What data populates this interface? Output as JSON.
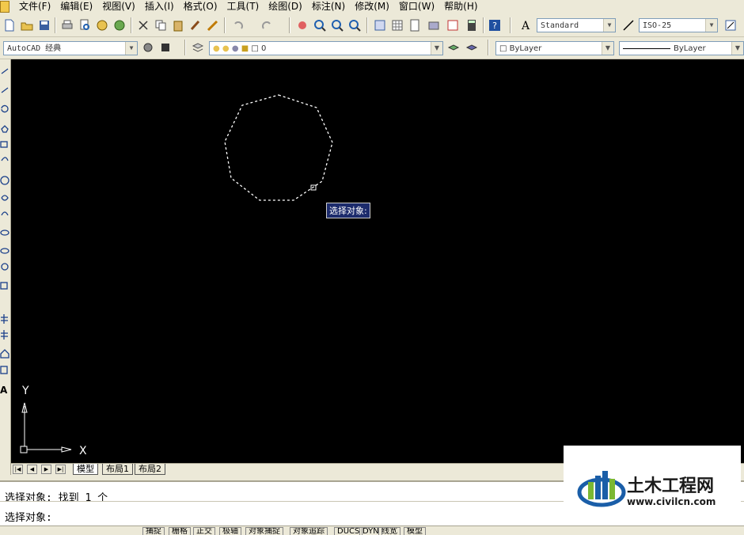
{
  "menu": [
    "文件(F)",
    "编辑(E)",
    "视图(V)",
    "插入(I)",
    "格式(O)",
    "工具(T)",
    "绘图(D)",
    "标注(N)",
    "修改(M)",
    "窗口(W)",
    "帮助(H)"
  ],
  "toolbar": {
    "text_style": "Standard",
    "dim_style": "ISO-25",
    "workspace": "AutoCAD 经典",
    "layer": "0",
    "color": "ByLayer",
    "linetype": "ByLayer"
  },
  "canvas": {
    "tooltip": "选择对象:",
    "ucs_y": "Y",
    "ucs_x": "X"
  },
  "tabs": [
    "模型",
    "布局1",
    "布局2"
  ],
  "command": {
    "line1": "选择对象: 找到 1 个",
    "line2": "选择对象:"
  },
  "status": [
    "捕捉",
    "栅格",
    "正交",
    "极轴",
    "对象捕捉",
    "对象追踪",
    "DUCS",
    "DYN",
    "线宽",
    "模型"
  ],
  "watermark": {
    "name": "土木工程网",
    "url": "www.civilcn.com"
  },
  "colors": {
    "canvas": "#000000",
    "chrome": "#ece9d8",
    "tooltip_bg": "#1c2b6c",
    "watermark_blue": "#1a5ea8",
    "watermark_green": "#7bb832"
  }
}
